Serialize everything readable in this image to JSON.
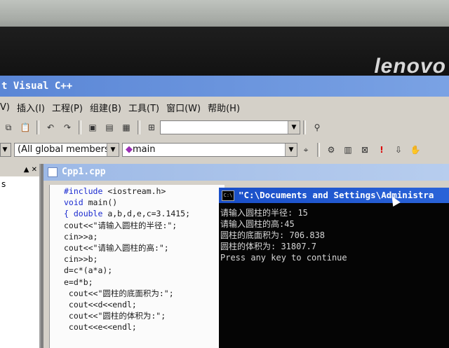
{
  "monitor": {
    "brand": "lenovo"
  },
  "ide": {
    "title": "t Visual C++",
    "menu": [
      "V)",
      "插入(I)",
      "工程(P)",
      "组建(B)",
      "工具(T)",
      "窗口(W)",
      "帮助(H)"
    ],
    "class_combo": "(All global members",
    "func_combo": "main",
    "left_pane_text": "s"
  },
  "document": {
    "title": "Cpp1.cpp",
    "code": [
      "#include <iostream.h>",
      "void main()",
      "{ double a,b,d,e,c=3.1415;",
      "cout<<\"请输入圆柱的半径:\";",
      "cin>>a;",
      "cout<<\"请输入圆柱的高:\";",
      "cin>>b;",
      "d=c*(a*a);",
      "e=d*b;",
      " cout<<\"圆柱的底面积为:\";",
      " cout<<d<<endl;",
      " cout<<\"圆柱的体积为:\";",
      " cout<<e<<endl;"
    ]
  },
  "console": {
    "icon_label": "C:\\",
    "title": "\"C:\\Documents and Settings\\Administra",
    "lines": [
      "请输入圆柱的半径: 15",
      "请输入圆柱的高:45",
      "圆柱的底面积为: 706.838",
      "圆柱的体积为: 31807.7",
      "Press any key to continue"
    ]
  }
}
